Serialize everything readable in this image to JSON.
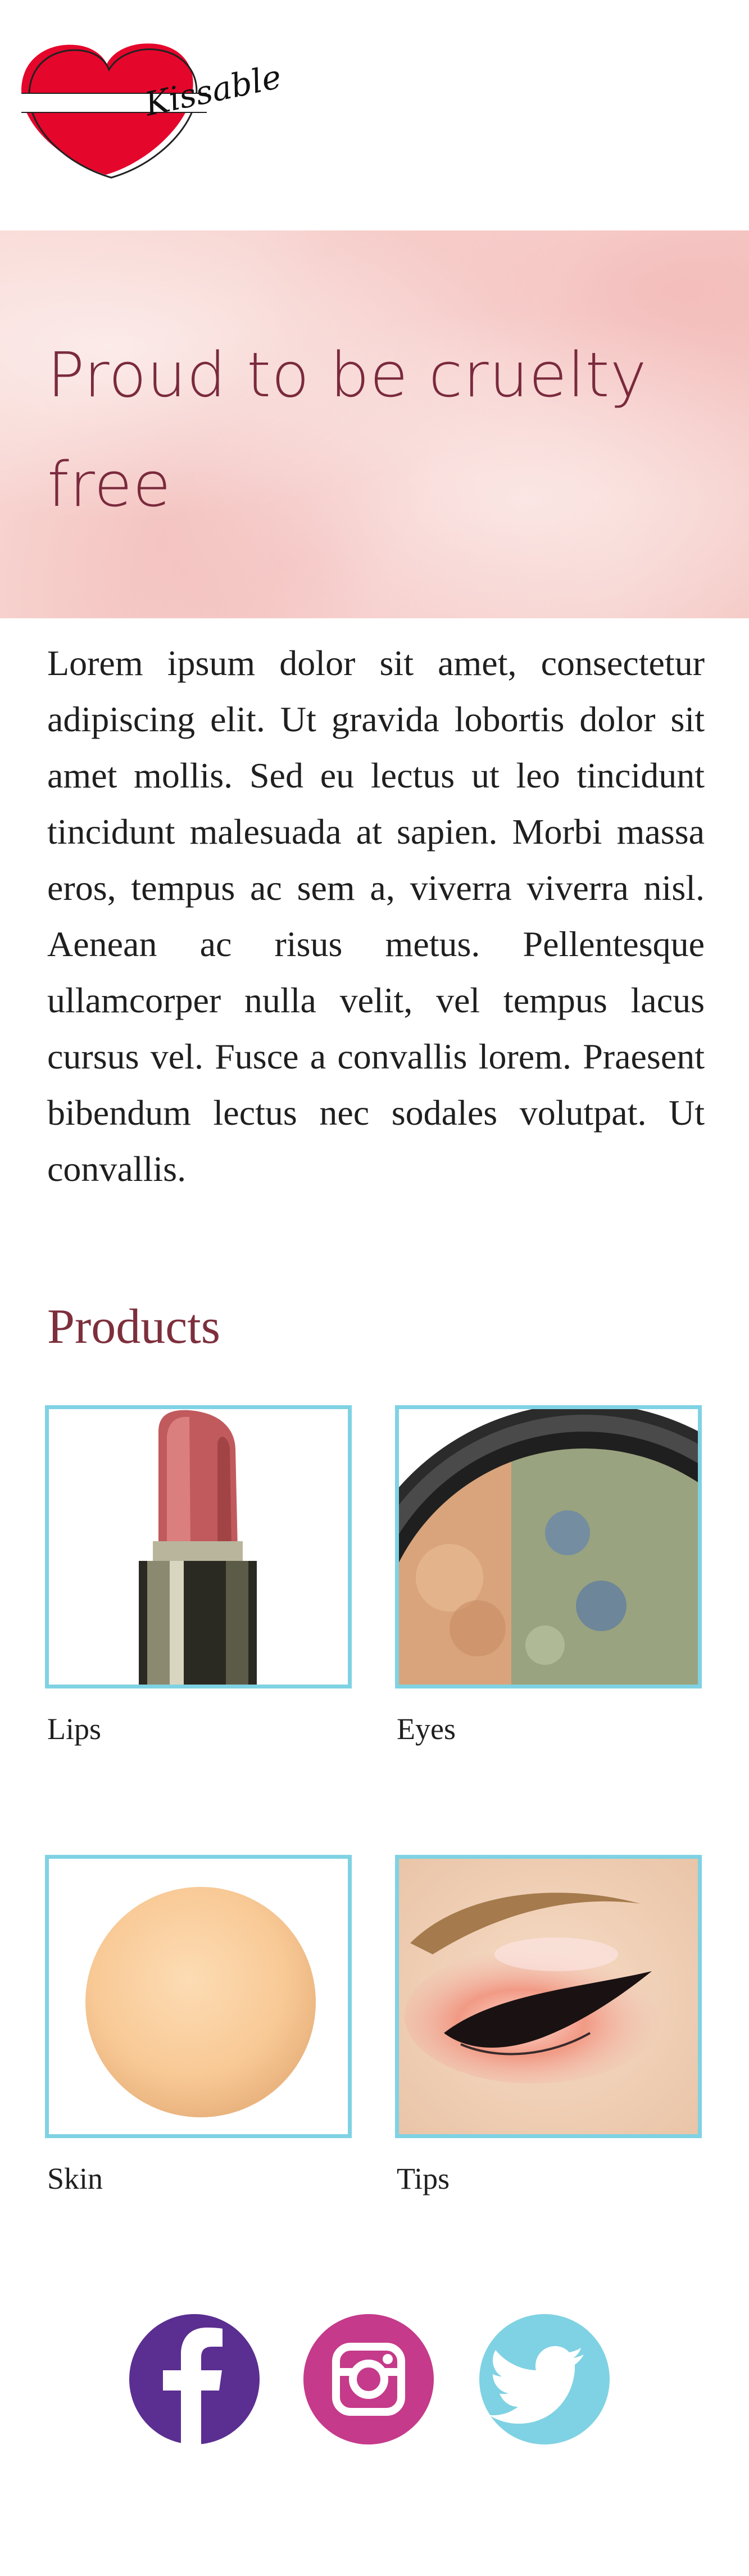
{
  "brand": {
    "logo_text": "Kissable",
    "logo_color": "#e5062b"
  },
  "hero": {
    "title": "Proud to be cruelty free",
    "title_color": "#7a2a3d"
  },
  "intro": {
    "text": "Lorem ipsum dolor sit amet, consectetur adipiscing elit. Ut gravida lobortis dolor sit amet mollis. Sed eu lectus ut leo tincidunt tincidunt malesuada at sapien. Morbi massa eros, tempus ac sem a, viverra viverra nisl. Aenean ac risus metus. Pellentesque ullamcorper nulla velit, vel tempus lacus cursus vel. Fusce a convallis lorem. Praesent bibendum lectus nec sodales volutpat. Ut convallis."
  },
  "products": {
    "title": "Products",
    "border_color": "#7fd2e3",
    "items": [
      {
        "label": "Lips",
        "icon": "lipstick-image"
      },
      {
        "label": "Eyes",
        "icon": "eyeshadow-compact-image"
      },
      {
        "label": "Skin",
        "icon": "foundation-swatch-image"
      },
      {
        "label": "Tips",
        "icon": "eye-makeup-image"
      }
    ]
  },
  "social": [
    {
      "name": "facebook-icon",
      "color": "#5b2e91"
    },
    {
      "name": "instagram-icon",
      "color": "#c53a8a"
    },
    {
      "name": "twitter-icon",
      "color": "#7fd2e3"
    }
  ]
}
